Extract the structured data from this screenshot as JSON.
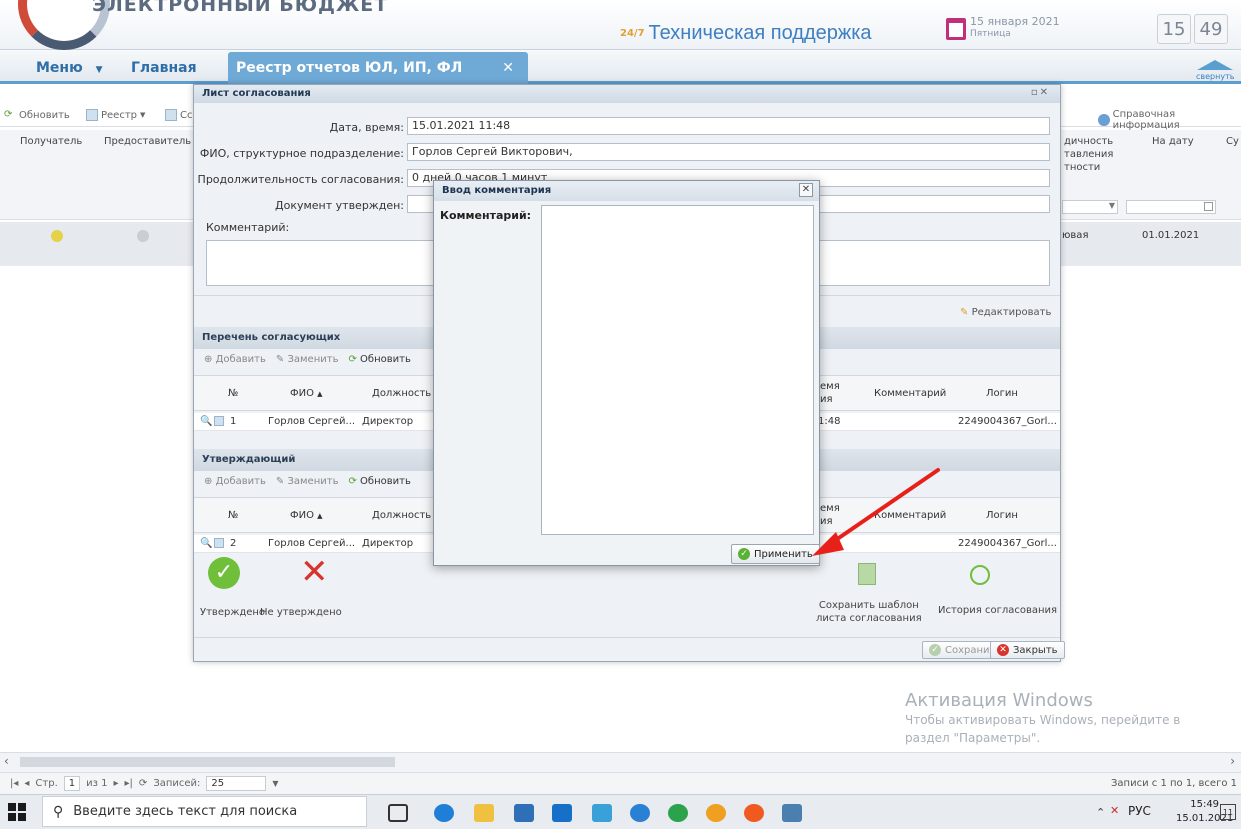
{
  "header": {
    "logo_text": "ЭЛЕКТРОННЫЙ БЮДЖЕТ",
    "support_badge": "24/7",
    "support_text": "Техническая поддержка",
    "date": "15 января 2021",
    "weekday": "Пятница",
    "clock_hours": "15",
    "clock_minutes": "49"
  },
  "nav": {
    "menu_label": "Меню",
    "home_label": "Главная",
    "active_tab": "Реестр отчетов ЮЛ, ИП, ФЛ",
    "collapse_label": "свернуть"
  },
  "bg_toolbar": {
    "refresh": "Обновить",
    "registry": "Реестр",
    "registry_trunc": "Сс",
    "help": "Справочная информация"
  },
  "bg_grid": {
    "col_recipient": "Получатель",
    "col_provider": "Предоставитель",
    "col_periodicity_1": "дичность",
    "col_periodicity_2": "тавления",
    "col_periodicity_3": "тности",
    "col_date": "На дату",
    "col_sum": "Су",
    "row_type": "ювая",
    "row_date": "01.01.2021"
  },
  "pager": {
    "page_label": "Стр.",
    "page_value": "1",
    "of_label": "из 1",
    "records_label": "Записей:",
    "records_value": "25",
    "total": "Записи с 1 по 1, всего 1"
  },
  "activation": {
    "title": "Активация Windows",
    "text": "Чтобы активировать Windows, перейдите в раздел \"Параметры\"."
  },
  "sheet": {
    "title": "Лист согласования",
    "date_label": "Дата, время:",
    "date_value": "15.01.2021 11:48",
    "fio_label": "ФИО, структурное подразделение:",
    "fio_value": "Горлов Сергей Викторович,",
    "duration_label": "Продолжительность согласования:",
    "duration_value": "0 дней 0 часов 1 минут",
    "approved_doc_label": "Документ утвержден:",
    "comment_label": "Комментарий:",
    "edit_label": "Редактировать",
    "approvers_section": "Перечень согласующих",
    "approver_section": "Утверждающий",
    "add_label": "Добавить",
    "replace_label": "Заменить",
    "refresh_label": "Обновить",
    "col_no": "№",
    "col_fio": "ФИО",
    "col_position": "Должность",
    "col_time_1": "емя",
    "col_time_2": "ия",
    "col_comment": "Комментарий",
    "col_login": "Логин",
    "approvers_rows": [
      {
        "no": "1",
        "fio": "Горлов Сергей...",
        "position": "Директор",
        "time": "1:48",
        "login": "2249004367_Gorl..."
      }
    ],
    "approver_rows": [
      {
        "no": "2",
        "fio": "Горлов Сергей...",
        "position": "Директор",
        "login": "2249004367_Gorl..."
      }
    ],
    "approved_label": "Утверждено",
    "not_approved_label": "Не утверждено",
    "save_template_1": "Сохранить шаблон",
    "save_template_2": "листа согласования",
    "history_label": "История согласования",
    "save_label": "Сохранить",
    "close_label": "Закрыть"
  },
  "dialog": {
    "title": "Ввод комментария",
    "comment_label": "Комментарий:",
    "comment_value": "",
    "apply_label": "Применить"
  },
  "taskbar": {
    "search_placeholder": "Введите здесь текст для поиска",
    "lang": "РУС",
    "time": "15:49",
    "date": "15.01.2021",
    "notif_count": "11"
  },
  "colors": {
    "accent": "#5b9fd1",
    "arrow": "#e8201a",
    "approve": "#6fbf3a",
    "reject": "#d8342e"
  }
}
